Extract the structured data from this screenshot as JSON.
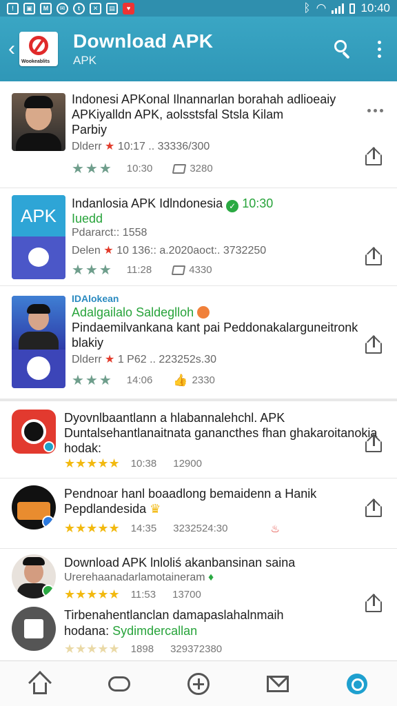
{
  "status_bar": {
    "time": "10:40",
    "icons": [
      "warning-icon",
      "photo-icon",
      "m-icon",
      "mail-icon",
      "tumblr-icon",
      "x-icon",
      "calendar-icon",
      "shield-icon"
    ],
    "system_icons": [
      "bluetooth-icon",
      "wifi-icon",
      "signal-icon",
      "battery-icon"
    ]
  },
  "app_bar": {
    "title": "Download APK",
    "subtitle": "APK",
    "logo_text": "Wookeablits",
    "colors": {
      "bar": "#2f97b7",
      "logo_ring": "#e02a2a"
    }
  },
  "items": [
    {
      "title_line1": "Indonesi APKonal Ilnannarlan borahah adlioeaiy",
      "title_line2": "APKiyalldn APK, aolsstsfal Stsla Kilam",
      "title_line3": "Parbiy",
      "meta_prefix": "Dlderr",
      "meta_value": "10:17 .. 33336/300",
      "stars": "★★★",
      "time": "10:30",
      "stat": "3280"
    },
    {
      "title_line1": "Indanlosia APK Idlndonesia",
      "badge_time": "10:30",
      "title_line2": "Iuedd",
      "title_line3": "Pdararct:: 1558",
      "meta_prefix": "Delen",
      "meta_value": "10 136:: a.2020aoct:. 3732250",
      "stars": "★★★",
      "time": "11:28",
      "stat": "4330",
      "thumb_label": "APK"
    },
    {
      "title_line0": "IDAlokean",
      "title_line1": "Adalgailalo Saldeglloh",
      "title_line2": "Pindaemilvankana kant pai Peddonakalarguneitronk",
      "title_line3": "blakiy",
      "meta_prefix": "Dlderr",
      "meta_value": "1 P62 .. 223252s.30",
      "stars": "★★★",
      "time": "14:06",
      "stat": "2330"
    },
    {
      "title_line1": "Dyovnlbaantlann a hlabannalehchl. APK",
      "title_line2": "Duntalsehantlanaitnata ganancthes fhan ghakaroitanokia",
      "title_line3": "hodak:",
      "stars": "★★★★★",
      "time": "10:38",
      "stat": "12900"
    },
    {
      "title_line1": "Pendnoar hanl boaadlong bemaidenn a Hanik",
      "title_line2": "Pepdlandesida",
      "stars": "★★★★★",
      "time": "14:35",
      "stat": "3232524:30"
    },
    {
      "title_line1": "Download APK lnloliś akanbansinan saina",
      "title_line2": "Urerehaanadarlamotaineram",
      "stars": "★★★★★",
      "time": "11:53",
      "stat": "13700"
    },
    {
      "title_line1": "Tirbenahentlanclan damapaslahalnmaih",
      "title_line2a": "hodana:",
      "title_line2b": "Sydimdercallan",
      "stars": "★★★★★",
      "time": "1898",
      "stat": "329372380"
    }
  ],
  "bottom_nav": [
    "home-icon",
    "cloud-icon",
    "add-icon",
    "mail-icon",
    "chat-icon"
  ]
}
